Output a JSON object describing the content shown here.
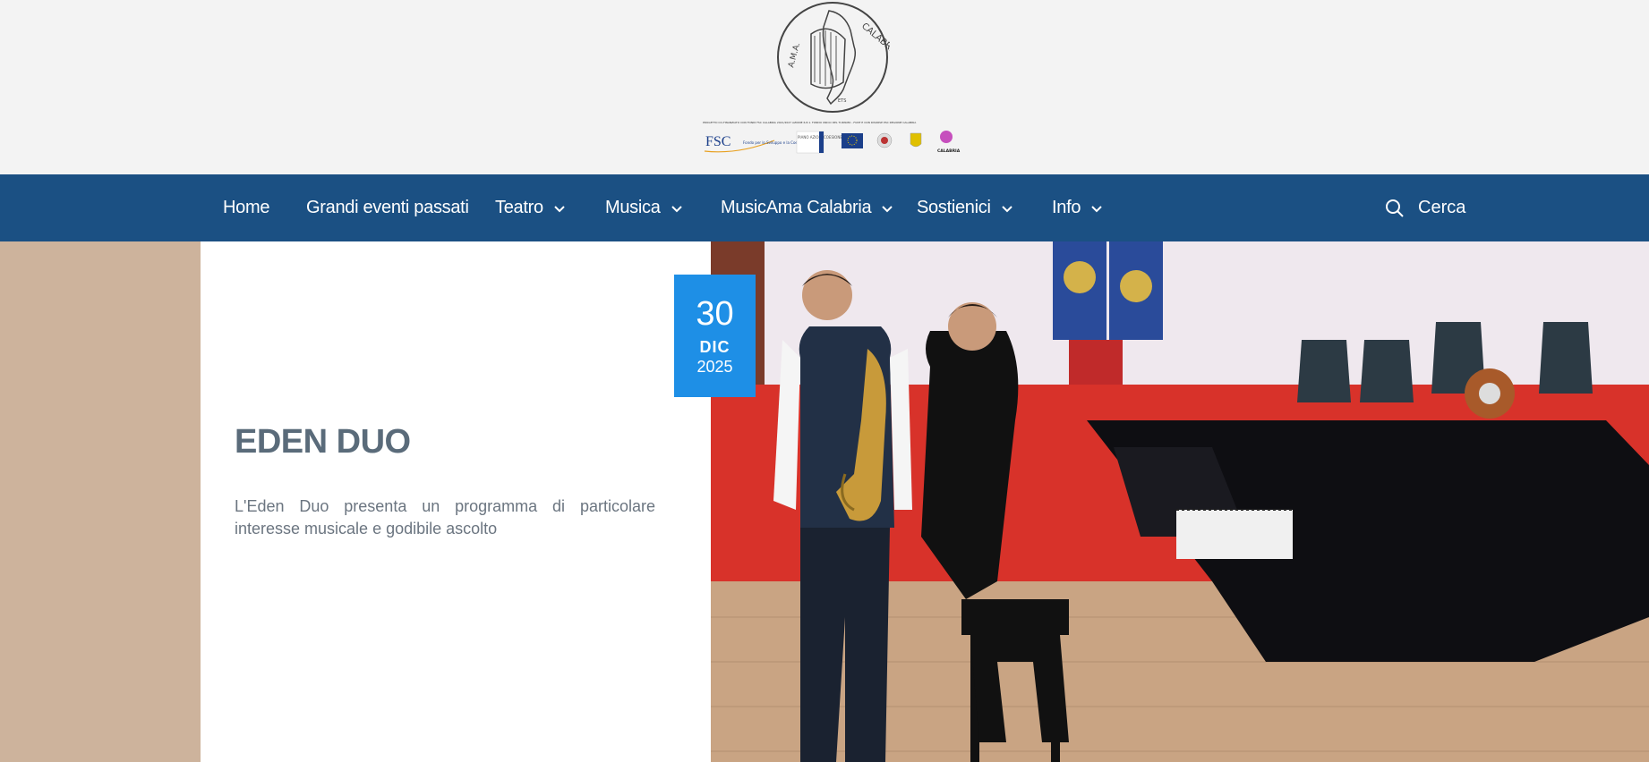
{
  "header": {
    "logo_text_top": "CALABRIA",
    "logo_text_left": "A.M.A.",
    "logo_text_bottom": "ETS",
    "sponsor_caption": "PROGETTO CO-FINANZIATO CON FONDI FSC CALABRIA 2021/2027 AZIONE 6.8.1. FONDO UNICO DEL TURISMO - FUNT E CON RISORSE PSC REGIONE CALABRIA",
    "sponsor_fsc": "FSC",
    "sponsor_fsc_sub": "Fondo per lo Sviluppo e la Coesione",
    "sponsor_piano": "PIANO AZIONI COESIONE",
    "sponsor_calabria": "CALABRIA"
  },
  "nav": {
    "items": [
      {
        "label": "Home",
        "dropdown": false
      },
      {
        "label": "Grandi eventi passati",
        "dropdown": false
      },
      {
        "label": "Teatro",
        "dropdown": true
      },
      {
        "label": "Musica",
        "dropdown": true
      },
      {
        "label": "MusicAma Calabria",
        "dropdown": true
      },
      {
        "label": "Sostienici",
        "dropdown": true
      },
      {
        "label": "Info",
        "dropdown": true
      }
    ],
    "search_label": "Cerca"
  },
  "event": {
    "day": "30",
    "month": "DIC",
    "year": "2025",
    "title": "EDEN DUO",
    "description": "L'Eden Duo presenta un programma di particolare interesse musicale e godibile ascolto"
  },
  "colors": {
    "nav_bg": "#1b5083",
    "badge_bg": "#1e8fe6",
    "hero_left": "#cdb39c"
  }
}
